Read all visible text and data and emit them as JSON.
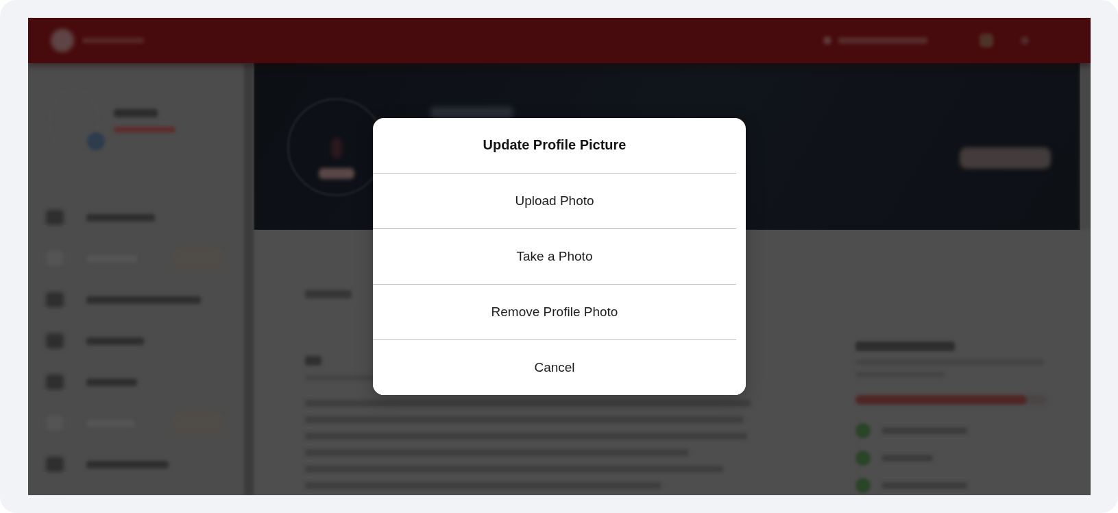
{
  "dialog": {
    "title": "Update Profile Picture",
    "options": [
      {
        "label": "Upload Photo"
      },
      {
        "label": "Take a Photo"
      },
      {
        "label": "Remove Profile Photo"
      },
      {
        "label": "Cancel"
      }
    ]
  }
}
